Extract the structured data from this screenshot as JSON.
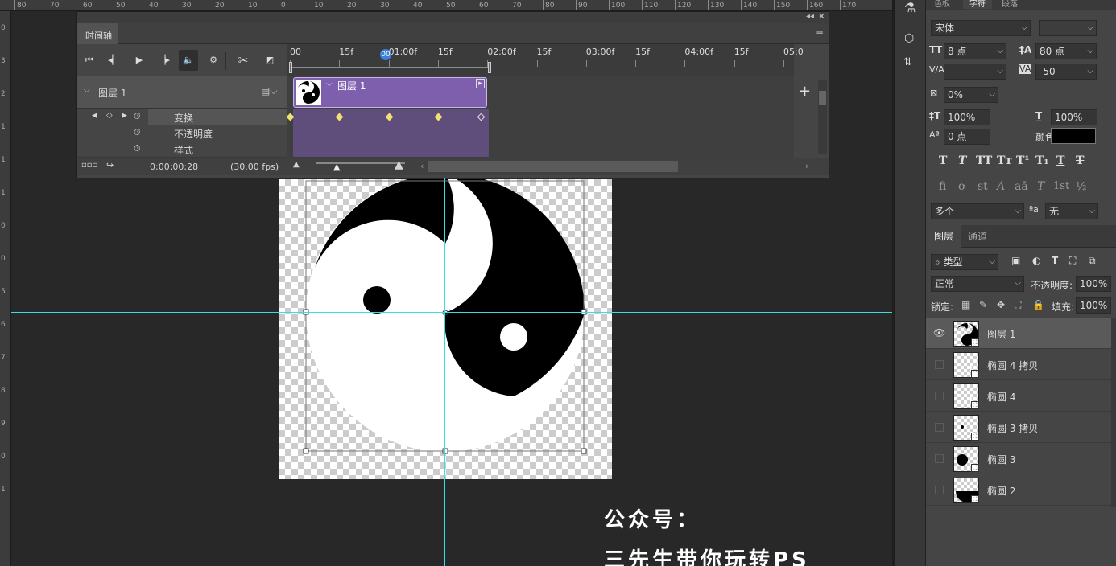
{
  "ruler_top": {
    "labels": [
      "80",
      "70",
      "60",
      "50",
      "40",
      "30",
      "20",
      "10",
      "0",
      "10",
      "20",
      "30",
      "40",
      "50",
      "60",
      "70",
      "80",
      "90",
      "100",
      "110",
      "120",
      "130",
      "140",
      "150",
      "160",
      "170"
    ]
  },
  "ruler_left": {
    "labels": [
      "0",
      "3",
      "2",
      "1",
      "1",
      "1",
      "0",
      "0",
      "5",
      "6",
      "7",
      "8",
      "9",
      "0",
      "1"
    ]
  },
  "timeline": {
    "title": "时间轴",
    "ruler_labels": [
      "00",
      "15f",
      "01:00f",
      "15f",
      "02:00f",
      "15f",
      "03:00f",
      "15f",
      "04:00f",
      "15f",
      "05:0"
    ],
    "playhead_label": "00",
    "layer_name": "图层 1",
    "clip_name": "图层 1",
    "properties": [
      "变换",
      "不透明度",
      "样式"
    ],
    "current_time": "0:00:00:28",
    "fps": "(30.00 fps)",
    "add_label": "+"
  },
  "character": {
    "tabs": [
      "色板",
      "字符",
      "段落"
    ],
    "font_family": "宋体",
    "font_style": "",
    "font_size": "8 点",
    "leading": "80 点",
    "kerning": "",
    "tracking": "-50",
    "scale_pct": "0%",
    "vertical_scale": "100%",
    "horizontal_scale": "100%",
    "baseline_shift": "0 点",
    "color_label": "颜色：",
    "color": "#000000",
    "language": "多个",
    "aa_label": "ªa",
    "anti_alias": "无",
    "style_buttons": [
      "T",
      "T",
      "TT",
      "Tт",
      "T¹",
      "T₁",
      "T",
      "T"
    ],
    "opentype_buttons": [
      "fi",
      "ơ",
      "st",
      "A",
      "aā",
      "T",
      "1st",
      "½"
    ]
  },
  "layers": {
    "tabs": [
      "图层",
      "通道"
    ],
    "filter_kind": "类型",
    "blend_mode": "正常",
    "opacity_label": "不透明度:",
    "opacity": "100%",
    "lock_label": "锁定:",
    "fill_label": "填充:",
    "fill": "100%",
    "items": [
      {
        "name": "图层 1",
        "visible": true,
        "active": true
      },
      {
        "name": "椭圆 4 拷贝",
        "visible": false,
        "active": false
      },
      {
        "name": "椭圆 4",
        "visible": false,
        "active": false
      },
      {
        "name": "椭圆 3 拷贝",
        "visible": false,
        "active": false
      },
      {
        "name": "椭圆 3",
        "visible": false,
        "active": false
      },
      {
        "name": "椭圆 2",
        "visible": false,
        "active": false
      }
    ]
  },
  "watermark": {
    "line1": "公众号：",
    "line2": "三先生带你玩转PS"
  },
  "colors": {
    "guide": "#36e0e0",
    "clip": "#7e5fad",
    "playhead": "#d42020",
    "keyframe": "#f2e070"
  }
}
